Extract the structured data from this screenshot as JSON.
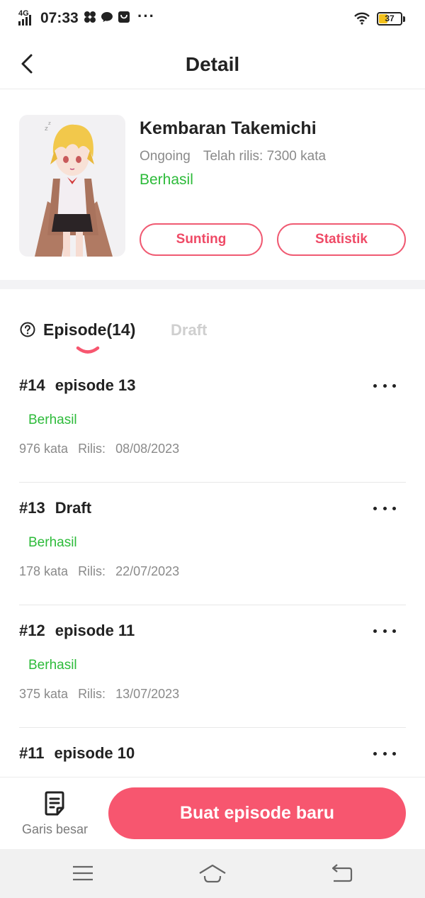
{
  "status_bar": {
    "network": "4G",
    "time": "07:33",
    "more": "···",
    "battery": "37",
    "battery_level": 0.37,
    "battery_color": "#f4c21c"
  },
  "header": {
    "title": "Detail"
  },
  "story": {
    "title": "Kembaran Takemichi",
    "state": "Ongoing",
    "released": "Telah rilis: 7300 kata",
    "review_status": "Berhasil",
    "edit_label": "Sunting",
    "stats_label": "Statistik"
  },
  "tabs": {
    "episode": "Episode(14)",
    "draft": "Draft"
  },
  "episodes": [
    {
      "number": "#14",
      "title": "episode 13",
      "status": "Berhasil",
      "words": "976 kata",
      "release_label": "Rilis:",
      "date": "08/08/2023"
    },
    {
      "number": "#13",
      "title": "Draft",
      "status": "Berhasil",
      "words": "178 kata",
      "release_label": "Rilis:",
      "date": "22/07/2023"
    },
    {
      "number": "#12",
      "title": "episode 11",
      "status": "Berhasil",
      "words": "375 kata",
      "release_label": "Rilis:",
      "date": "13/07/2023"
    },
    {
      "number": "#11",
      "title": "episode 10"
    }
  ],
  "bottom_bar": {
    "outline_label": "Garis besar",
    "new_episode_label": "Buat episode baru"
  },
  "colors": {
    "accent": "#f7566f",
    "success": "#2dbb3a",
    "muted": "#8a8a8a"
  },
  "icons": [
    "back-icon",
    "help-icon",
    "more-icon",
    "outline-icon",
    "menu-icon",
    "home-icon",
    "return-icon",
    "wifi-icon",
    "battery-icon"
  ]
}
